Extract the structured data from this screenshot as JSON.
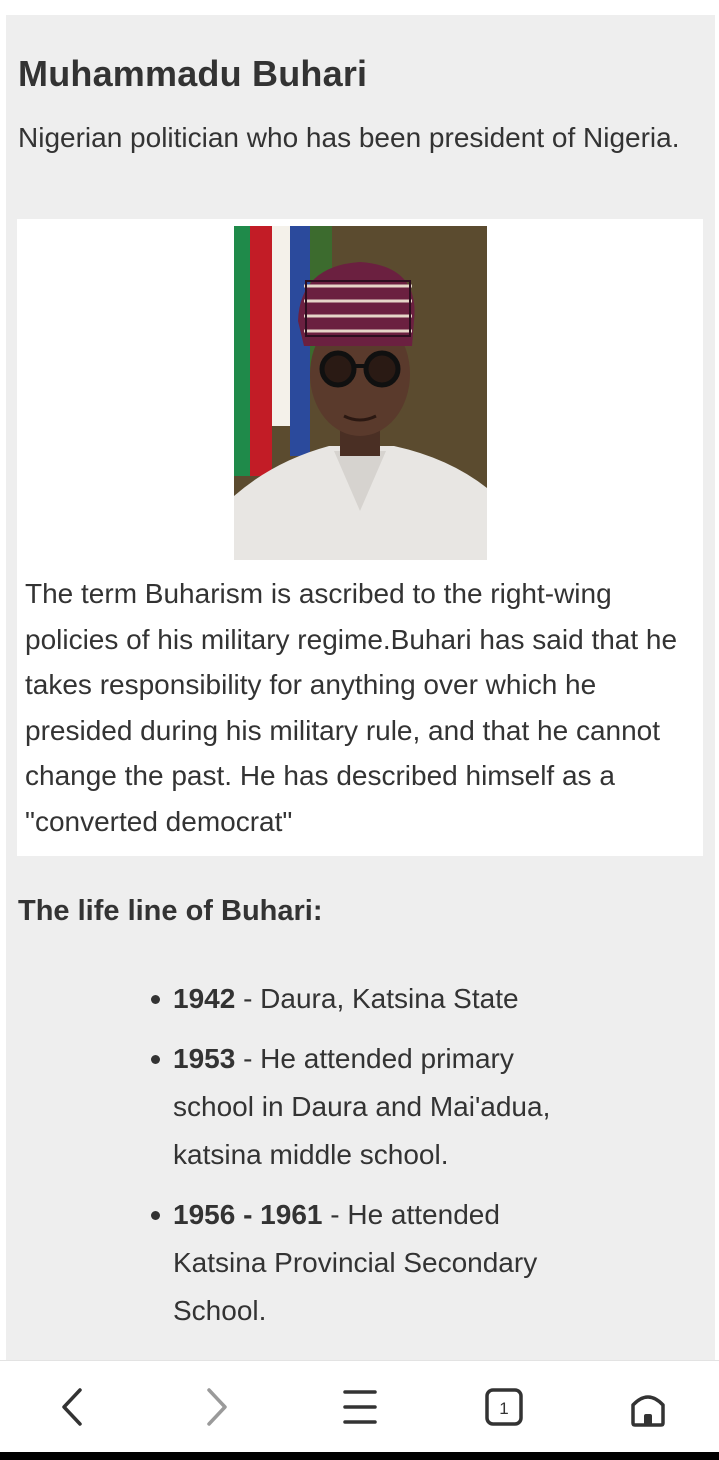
{
  "article": {
    "title": "Muhammadu Buhari",
    "subtitle": "Nigerian politician who has been president of Nigeria.",
    "image_alt": "Portrait of Muhammadu Buhari",
    "caption": "The term Buharism is ascribed to the right-wing policies of his military regime.Buhari has said that he takes responsibility for anything over which he presided during his military rule, and that he cannot change the past. He has described himself as a \"converted democrat\""
  },
  "lifeline": {
    "heading": "The life line of Buhari:",
    "items": [
      {
        "year": "1942",
        "text": " - Daura, Katsina State"
      },
      {
        "year": "1953",
        "text": " - He attended primary school in Daura and Mai'adua, katsina middle school."
      },
      {
        "year": "1956 - 1961",
        "text": " - He attended Katsina Provincial Secondary School."
      }
    ]
  },
  "browser_nav": {
    "tab_count": "1",
    "icons": [
      "back-icon",
      "forward-icon",
      "menu-icon",
      "tabs-icon",
      "home-icon"
    ],
    "colors": {
      "icon": "#333333",
      "disabled_icon": "#9a9a9a",
      "page_bg": "#eeeeee",
      "card_bg": "#ffffff"
    }
  }
}
